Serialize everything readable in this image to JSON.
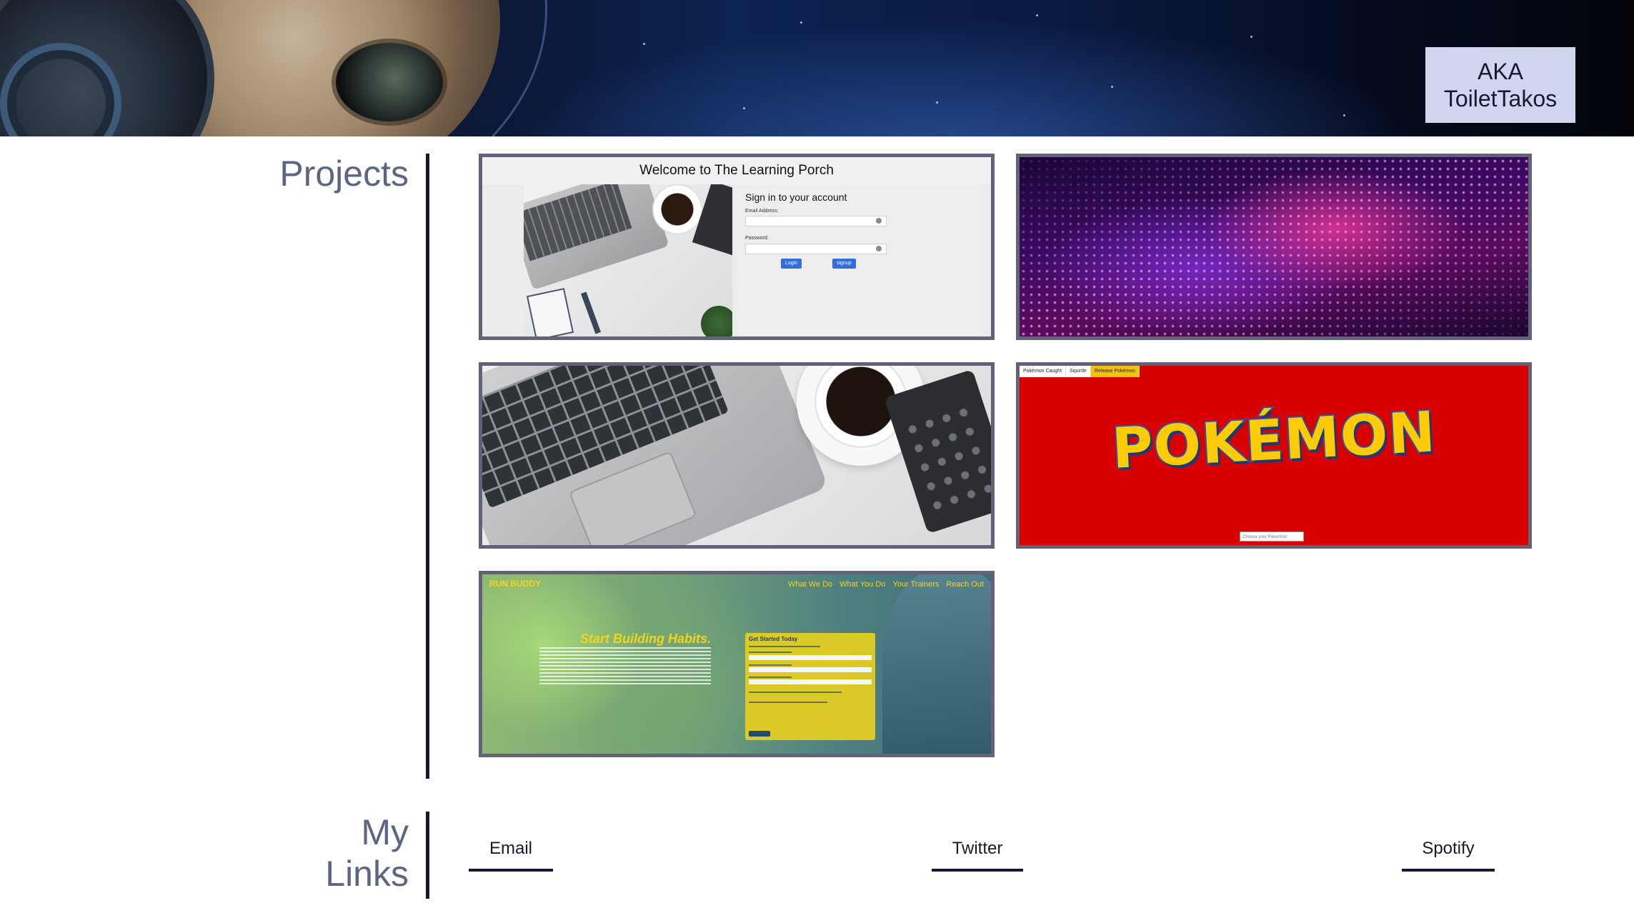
{
  "header": {
    "aka_line1": "AKA",
    "aka_line2": "ToiletTakos",
    "colors": {
      "banner_background": "#0b1633",
      "aka_box": "#cfd6ee"
    }
  },
  "projects": {
    "title": "Projects",
    "cards": [
      {
        "kind": "learning-porch",
        "heading": "Welcome to The Learning Porch",
        "signin_title": "Sign in to your account",
        "email_label": "Email Address:",
        "password_label": "Password:",
        "login_button": "Login",
        "signup_button": "signup"
      },
      {
        "kind": "dot-wave"
      },
      {
        "kind": "laptop-desk"
      },
      {
        "kind": "pokemon",
        "tabs": [
          "Pokémon Caught",
          "Squirtle",
          "Release Pokémon"
        ],
        "logo": "POKÉMON",
        "input_placeholder": "Choose your Pokemon!"
      },
      {
        "kind": "run-buddy",
        "brand": "RUN BUDDY",
        "nav": [
          "What We Do",
          "What You Do",
          "Your Trainers",
          "Reach Out"
        ],
        "headline": "Start Building Habits.",
        "form_title": "Get Started Today"
      }
    ]
  },
  "links": {
    "title_line1": "My",
    "title_line2": "Links",
    "items": [
      "Email",
      "Twitter",
      "Spotify"
    ]
  },
  "colors": {
    "section_title": "#5e6583",
    "divider": "#151a2e",
    "card_border": "#62637a"
  }
}
